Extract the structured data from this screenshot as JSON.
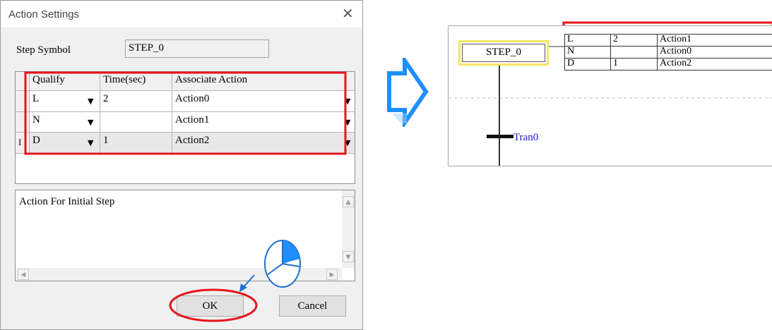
{
  "dialog": {
    "title": "Action Settings",
    "close_glyph": "✕",
    "step_symbol_label": "Step Symbol",
    "step_symbol_value": "STEP_0",
    "columns": [
      "Qualify",
      "Time(sec)",
      "Associate Action"
    ],
    "rows": [
      {
        "marker": "",
        "qualify": "L",
        "time": "2",
        "action": "Action0"
      },
      {
        "marker": "",
        "qualify": "N",
        "time": "",
        "action": "Action1"
      },
      {
        "marker": "I",
        "qualify": "D",
        "time": "1",
        "action": "Action2"
      }
    ],
    "description": "Action For Initial Step",
    "ok_label": "OK",
    "cancel_label": "Cancel"
  },
  "diagram": {
    "step_name": "STEP_0",
    "actions": [
      {
        "qualify": "L",
        "time": "2",
        "action": "Action1"
      },
      {
        "qualify": "N",
        "time": "",
        "action": "Action0"
      },
      {
        "qualify": "D",
        "time": "1",
        "action": "Action2"
      }
    ],
    "transition": "Tran0"
  },
  "colors": {
    "highlight": "#e8141c",
    "arrow_fill": "#1f8fff",
    "step_border": "#f5e663",
    "transition_text": "#1a1acc"
  }
}
